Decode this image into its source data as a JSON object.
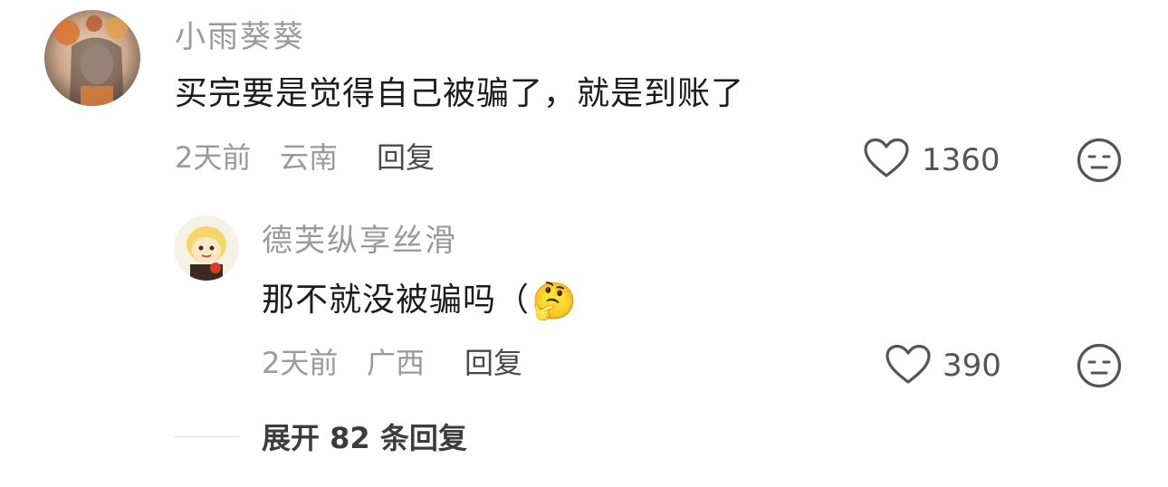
{
  "comment": {
    "username": "小雨葵葵",
    "text": "买完要是觉得自己被骗了，就是到账了",
    "time": "2天前",
    "location": "云南",
    "reply_label": "回复",
    "likes": "1360"
  },
  "reply": {
    "username": "德芙纵享丝滑",
    "text": "那不就没被骗吗（",
    "emoji": "🤔",
    "time": "2天前",
    "location": "广西",
    "reply_label": "回复",
    "likes": "390"
  },
  "expand": {
    "label": "展开 82 条回复"
  },
  "icons": {
    "like": "heart-outline-icon",
    "dislike": "neutral-face-icon"
  }
}
